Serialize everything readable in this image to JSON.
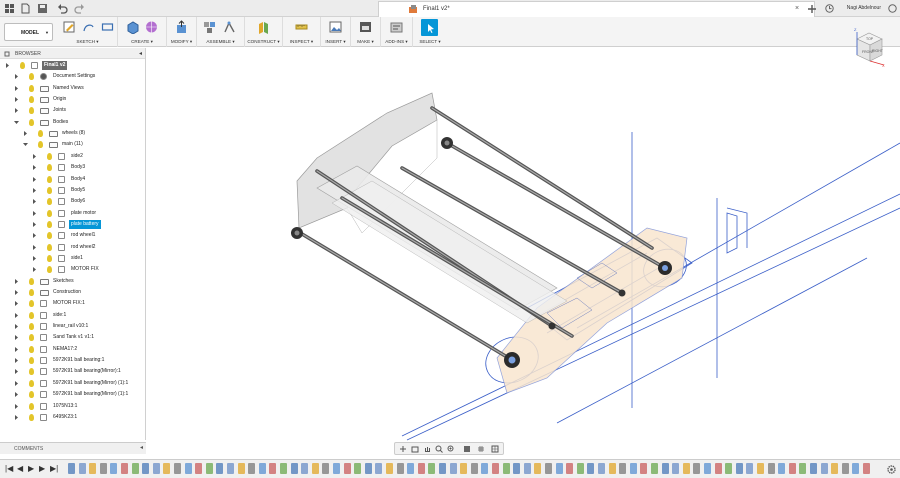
{
  "title_bar": {
    "document_title": "Final1 v2*",
    "user_name": "Nagi Abdelnour",
    "close_glyph": "×",
    "quick_icons": [
      "grid-icon",
      "file-icon",
      "save-icon",
      "undo-icon",
      "redo-icon"
    ],
    "window_icons": [
      "add-tab-icon",
      "clock-icon",
      "help-icon",
      "refresh-icon"
    ]
  },
  "toolbar": {
    "workspace": "MODEL",
    "workspace_caret": "▼",
    "groups": [
      {
        "label": "SKETCH ▾",
        "icons": [
          "sketch-icon",
          "line-icon",
          "rectangle-icon"
        ]
      },
      {
        "label": "CREATE ▾",
        "icons": [
          "extrude-icon",
          "form-icon"
        ]
      },
      {
        "label": "MODIFY ▾",
        "icons": [
          "press-pull-icon"
        ]
      },
      {
        "label": "ASSEMBLE ▾",
        "icons": [
          "new-component-icon",
          "joint-icon"
        ]
      },
      {
        "label": "CONSTRUCT ▾",
        "icons": [
          "plane-icon"
        ]
      },
      {
        "label": "INSPECT ▾",
        "icons": [
          "measure-icon"
        ]
      },
      {
        "label": "INSERT ▾",
        "icons": [
          "insert-image-icon"
        ]
      },
      {
        "label": "MAKE ▾",
        "icons": [
          "3d-print-icon"
        ]
      },
      {
        "label": "ADD-INS ▾",
        "icons": [
          "add-ins-icon"
        ]
      },
      {
        "label": "SELECT ▾",
        "icons": [
          "select-icon"
        ]
      }
    ],
    "accent_color": "#0696d7"
  },
  "browser": {
    "header": "BROWSER",
    "collapse_glyph": "◂",
    "rows": [
      {
        "label": "Final1 v2",
        "depth": 0,
        "icon": "component",
        "header": true
      },
      {
        "label": "Document Settings",
        "depth": 1,
        "icon": "gear"
      },
      {
        "label": "Named Views",
        "depth": 1,
        "icon": "folder"
      },
      {
        "label": "Origin",
        "depth": 1,
        "icon": "folder"
      },
      {
        "label": "Joints",
        "depth": 1,
        "icon": "folder"
      },
      {
        "label": "Bodies",
        "depth": 1,
        "icon": "folder",
        "expanded": true
      },
      {
        "label": "wheels (8)",
        "depth": 2,
        "icon": "folder"
      },
      {
        "label": "main (11)",
        "depth": 2,
        "icon": "folder",
        "expanded": true
      },
      {
        "label": "side2",
        "depth": 3,
        "icon": "body"
      },
      {
        "label": "Body3",
        "depth": 3,
        "icon": "body"
      },
      {
        "label": "Body4",
        "depth": 3,
        "icon": "body"
      },
      {
        "label": "Body5",
        "depth": 3,
        "icon": "body"
      },
      {
        "label": "Body6",
        "depth": 3,
        "icon": "body"
      },
      {
        "label": "plate motor",
        "depth": 3,
        "icon": "body"
      },
      {
        "label": "plate battery",
        "depth": 3,
        "icon": "body",
        "selected": true
      },
      {
        "label": "rod wheel1",
        "depth": 3,
        "icon": "body"
      },
      {
        "label": "rod wheel2",
        "depth": 3,
        "icon": "body"
      },
      {
        "label": "side1",
        "depth": 3,
        "icon": "body"
      },
      {
        "label": "MOTOR FIX",
        "depth": 3,
        "icon": "body"
      },
      {
        "label": "Sketches",
        "depth": 1,
        "icon": "folder"
      },
      {
        "label": "Construction",
        "depth": 1,
        "icon": "folder"
      },
      {
        "label": "MOTOR FIX:1",
        "depth": 1,
        "icon": "component"
      },
      {
        "label": "side:1",
        "depth": 1,
        "icon": "component"
      },
      {
        "label": "linear_rail v10:1",
        "depth": 1,
        "icon": "component"
      },
      {
        "label": "Sand Tank v1 v1:1",
        "depth": 1,
        "icon": "component"
      },
      {
        "label": "NEMA17:2",
        "depth": 1,
        "icon": "component"
      },
      {
        "label": "5972K91 ball bearing:1",
        "depth": 1,
        "icon": "component"
      },
      {
        "label": "5972K91 ball bearing(Mirror):1",
        "depth": 1,
        "icon": "component"
      },
      {
        "label": "5972K91 ball bearing(Mirror) (1):1",
        "depth": 1,
        "icon": "component"
      },
      {
        "label": "5972K91 ball bearing(Mirror) (1):1",
        "depth": 1,
        "icon": "component"
      },
      {
        "label": "1075N13:1",
        "depth": 1,
        "icon": "component"
      },
      {
        "label": "6495K23:1",
        "depth": 1,
        "icon": "component"
      }
    ]
  },
  "comments": {
    "label": "COMMENTS",
    "toggle_glyph": "◂"
  },
  "viewcube": {
    "top": "TOP",
    "front": "FRONT",
    "right": "RIGHT",
    "axis_x": "X",
    "axis_y": "Y",
    "axis_z": "Z"
  },
  "nav_bar": {
    "icons": [
      "orbit-icon",
      "look-at-icon",
      "pan-icon",
      "zoom-icon",
      "fit-icon",
      "display-settings-icon",
      "grid-settings-icon",
      "viewports-icon"
    ]
  },
  "timeline": {
    "controls": [
      "skip-start-icon",
      "step-back-icon",
      "play-icon",
      "step-forward-icon",
      "skip-end-icon"
    ],
    "control_glyphs": [
      "|◀",
      "◀",
      "▶",
      "▶",
      "▶|"
    ],
    "settings_icon": "gear-icon"
  }
}
